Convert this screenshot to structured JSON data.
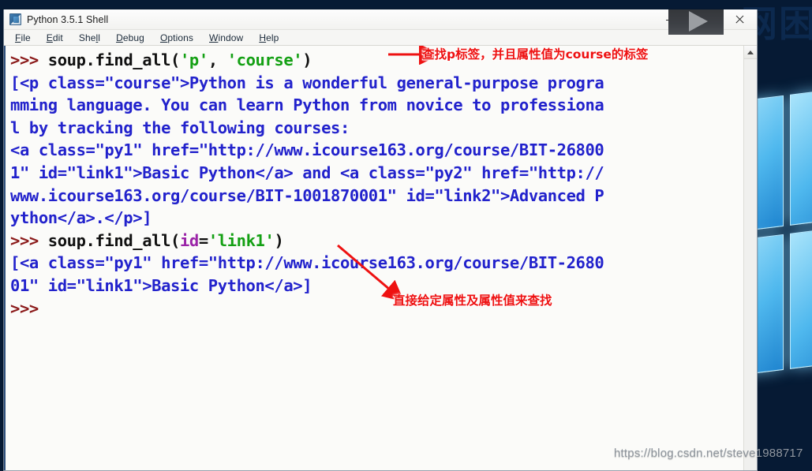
{
  "desktop": {
    "watermark_url_dim": "https://blog.csdn.net/steve",
    "watermark_url_bright": "1988717",
    "corner_chinese": "网困"
  },
  "window": {
    "title": "Python 3.5.1 Shell",
    "app_icon": "python-idle-icon",
    "controls": {
      "minimize": "minimize-icon",
      "maximize": "maximize-icon",
      "close": "close-icon"
    },
    "menu": [
      {
        "label": "File",
        "accel": "F"
      },
      {
        "label": "Edit",
        "accel": "E"
      },
      {
        "label": "Shell",
        "accel": "l"
      },
      {
        "label": "Debug",
        "accel": "D"
      },
      {
        "label": "Options",
        "accel": "O"
      },
      {
        "label": "Window",
        "accel": "W"
      },
      {
        "label": "Help",
        "accel": "H"
      }
    ],
    "scrollbar": {
      "up_arrow": "scroll-up-icon"
    }
  },
  "shell": {
    "lines": [
      {
        "type": "prompt-line",
        "prompt": ">>> ",
        "segments": [
          {
            "cls": "cd",
            "t": "soup.find_all("
          },
          {
            "cls": "str",
            "t": "'p'"
          },
          {
            "cls": "cd",
            "t": ", "
          },
          {
            "cls": "str",
            "t": "'course'"
          },
          {
            "cls": "cd",
            "t": ")"
          }
        ]
      },
      {
        "type": "output",
        "text": "[<p class=\"course\">Python is a wonderful general-purpose progra"
      },
      {
        "type": "output",
        "text": "mming language. You can learn Python from novice to professiona"
      },
      {
        "type": "output",
        "text": "l by tracking the following courses:"
      },
      {
        "type": "output",
        "text": "<a class=\"py1\" href=\"http://www.icourse163.org/course/BIT-26800"
      },
      {
        "type": "output",
        "text": "1\" id=\"link1\">Basic Python</a> and <a class=\"py2\" href=\"http://"
      },
      {
        "type": "output",
        "text": "www.icourse163.org/course/BIT-1001870001\" id=\"link2\">Advanced P"
      },
      {
        "type": "output",
        "text": "ython</a>.</p>]"
      },
      {
        "type": "prompt-line",
        "prompt": ">>> ",
        "segments": [
          {
            "cls": "cd",
            "t": "soup.find_all("
          },
          {
            "cls": "kw",
            "t": "id"
          },
          {
            "cls": "cd",
            "t": "="
          },
          {
            "cls": "str",
            "t": "'link1'"
          },
          {
            "cls": "cd",
            "t": ")"
          }
        ]
      },
      {
        "type": "output",
        "text": "[<a class=\"py1\" href=\"http://www.icourse163.org/course/BIT-2680"
      },
      {
        "type": "output",
        "text": "01\" id=\"link1\">Basic Python</a>]"
      },
      {
        "type": "prompt-line",
        "prompt": ">>> ",
        "segments": []
      }
    ]
  },
  "annotations": {
    "note1": "查找p标签，并且属性值为course的标签",
    "note2": "直接给定属性及属性值来查找",
    "arrow1": "red-arrow-right",
    "arrow2": "red-arrow-down-left"
  },
  "colors": {
    "prompt": "#8b1a1a",
    "string": "#14a014",
    "keyword": "#9b24a8",
    "output": "#2222cc",
    "annotation": "#ee1111",
    "desktop": "#061a34"
  }
}
